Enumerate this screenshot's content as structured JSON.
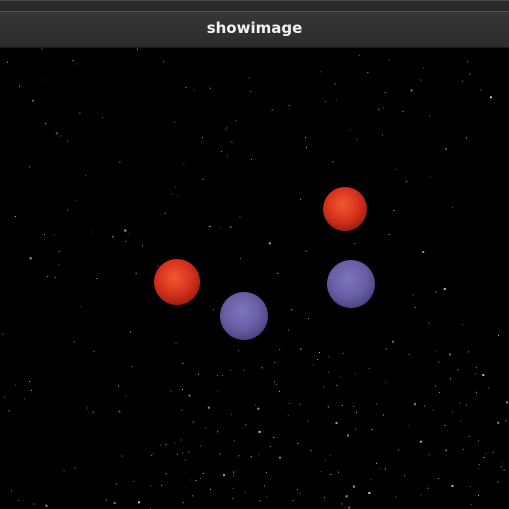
{
  "window": {
    "title": "showimage"
  },
  "image": {
    "description_colors": {
      "background": "#000000",
      "red_ball": "#d8321e",
      "purple_ball": "#6a5fa6"
    },
    "balls": [
      {
        "color": "red"
      },
      {
        "color": "red"
      },
      {
        "color": "purple"
      },
      {
        "color": "purple"
      }
    ]
  }
}
